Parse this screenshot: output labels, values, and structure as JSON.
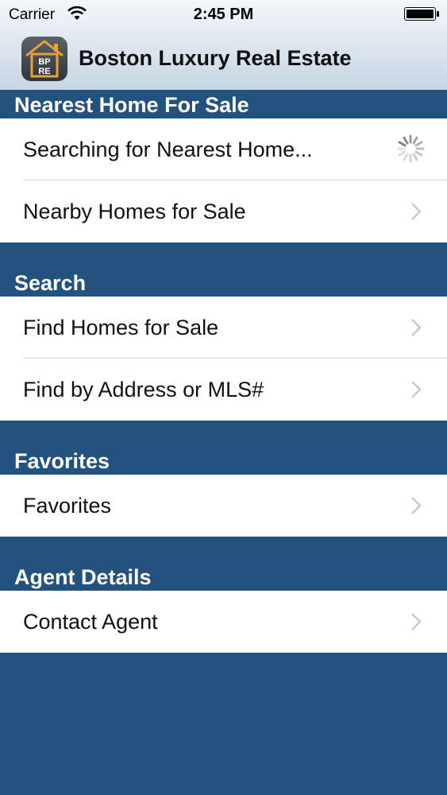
{
  "status_bar": {
    "carrier": "Carrier",
    "time": "2:45 PM",
    "wifi_icon": "wifi-icon",
    "battery_icon": "battery-full-icon"
  },
  "header": {
    "title": "Boston Luxury Real Estate",
    "logo_icon": "house-logo-icon",
    "logo_text": [
      "BP",
      "RE"
    ]
  },
  "sections": {
    "nearest": {
      "title": "Nearest Home For Sale",
      "rows": [
        {
          "label": "Searching for Nearest Home...",
          "accessory": "spinner-icon"
        },
        {
          "label": "Nearby Homes for Sale",
          "accessory": "chevron-right-icon"
        }
      ]
    },
    "search": {
      "title": "Search",
      "rows": [
        {
          "label": "Find Homes for Sale",
          "accessory": "chevron-right-icon"
        },
        {
          "label": "Find by Address or MLS#",
          "accessory": "chevron-right-icon"
        }
      ]
    },
    "favorites": {
      "title": "Favorites",
      "rows": [
        {
          "label": "Favorites",
          "accessory": "chevron-right-icon"
        }
      ]
    },
    "agent": {
      "title": "Agent Details",
      "rows": [
        {
          "label": "Contact Agent",
          "accessory": "chevron-right-icon"
        }
      ]
    }
  },
  "colors": {
    "background": "#24527f",
    "header_gradient_top": "#f4f7fa",
    "header_gradient_bottom": "#c6d6e4",
    "row_background": "#ffffff",
    "chevron": "#c7c7cc",
    "logo_accent": "#e7a238"
  }
}
